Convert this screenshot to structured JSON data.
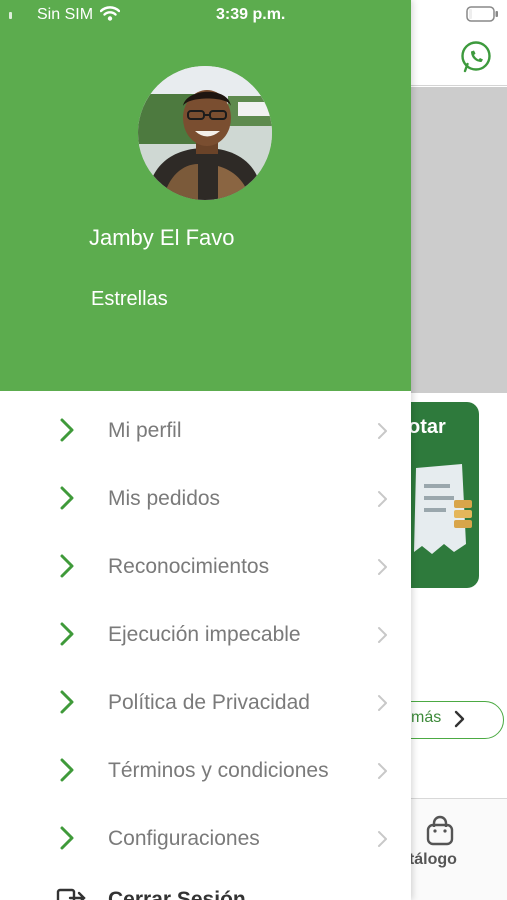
{
  "status_bar": {
    "carrier": "Sin SIM",
    "time": "3:39 p.m."
  },
  "profile": {
    "name": "Jamby El Favo",
    "tier": "Estrellas"
  },
  "menu": {
    "items": [
      {
        "label": "Mi perfil",
        "icon": "chevron-right-icon"
      },
      {
        "label": "Mis pedidos",
        "icon": "chevron-right-icon"
      },
      {
        "label": "Reconocimientos",
        "icon": "chevron-right-icon"
      },
      {
        "label": "Ejecución impecable",
        "icon": "chevron-right-icon"
      },
      {
        "label": "Política de Privacidad",
        "icon": "chevron-right-icon"
      },
      {
        "label": "Términos y condiciones",
        "icon": "chevron-right-icon"
      },
      {
        "label": "Configuraciones",
        "icon": "chevron-right-icon"
      }
    ],
    "logout_label": "Cerrar Sesión"
  },
  "background": {
    "promo_text": "otar",
    "more_label": "más",
    "tab_label": "atálogo"
  },
  "colors": {
    "brand_green": "#5cac4e",
    "chevron_green": "#3f9a3a",
    "promo_green": "#2e7a3c",
    "menu_text": "#7a7a7a"
  }
}
